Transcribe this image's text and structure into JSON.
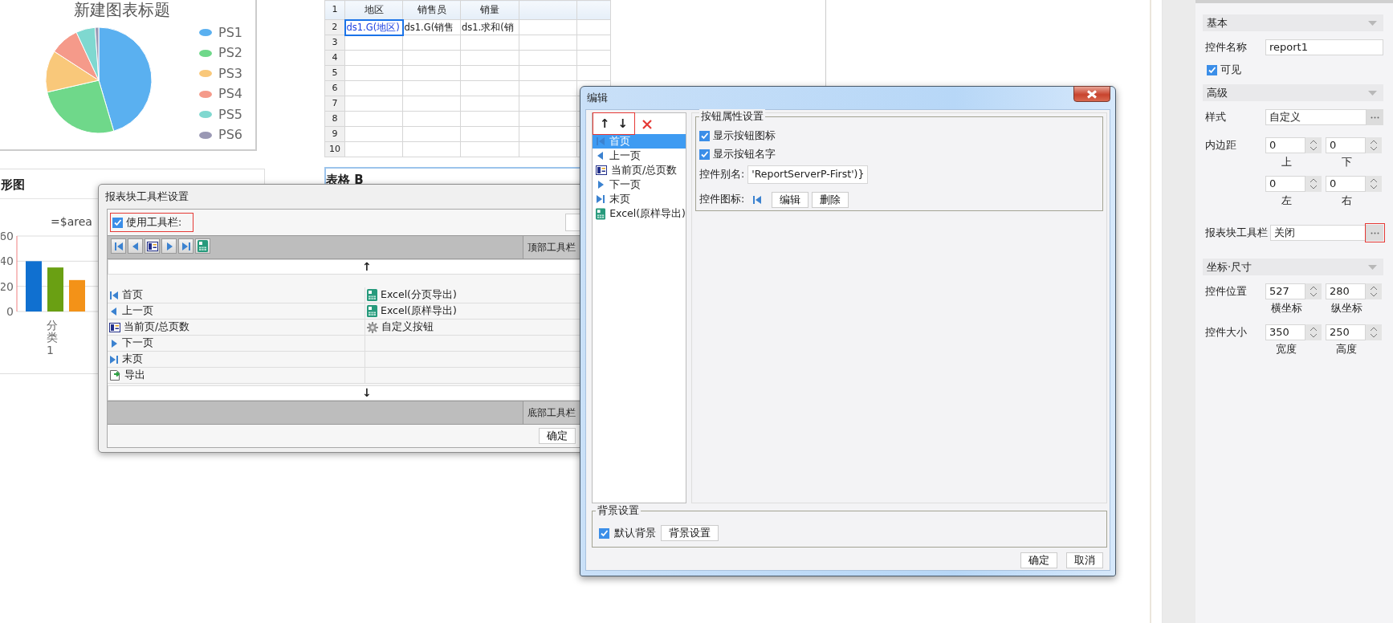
{
  "pie_chart": {
    "title": "新建图表标题",
    "legend": [
      {
        "label": "PS1",
        "color": "#5ab0f0"
      },
      {
        "label": "PS2",
        "color": "#6fd88a"
      },
      {
        "label": "PS3",
        "color": "#f9c87a"
      },
      {
        "label": "PS4",
        "color": "#f59a8a"
      },
      {
        "label": "PS5",
        "color": "#7fd8d0"
      },
      {
        "label": "PS6",
        "color": "#9a98b4"
      }
    ]
  },
  "spreadsheet": {
    "row_numbers": [
      "1",
      "2",
      "3",
      "4",
      "5",
      "6",
      "7",
      "8",
      "9",
      "10"
    ],
    "header": [
      "地区",
      "销售员",
      "销量"
    ],
    "cells": [
      {
        "text": "ds1.G(地区)",
        "selected": true
      },
      {
        "text": "ds1.G(销售",
        "selected": false
      },
      {
        "text": "ds1.求和(销",
        "selected": false
      }
    ]
  },
  "bar_chart": {
    "title": "形图",
    "chart_data": {
      "type": "bar",
      "title": "=$area",
      "categories": [
        "分类1"
      ],
      "series": [
        {
          "color": "#1070d0",
          "values": [
            40
          ]
        },
        {
          "color": "#6aa013",
          "values": [
            35
          ]
        },
        {
          "color": "#f39218",
          "values": [
            25
          ]
        }
      ],
      "ylim": [
        0,
        60
      ],
      "yticks": [
        0,
        20,
        40,
        60
      ]
    }
  },
  "table_b": {
    "title": "表格 B"
  },
  "toolbar_dialog": {
    "title": "报表块工具栏设置",
    "use_toolbar": {
      "label": "使用工具栏:",
      "checked": true,
      "highlighted": true
    },
    "top_toolbar": {
      "label": "顶部工具栏",
      "buttons": [
        {
          "kind": "first"
        },
        {
          "kind": "prev"
        },
        {
          "kind": "page_info"
        },
        {
          "kind": "next"
        },
        {
          "kind": "last"
        },
        {
          "kind": "excel"
        }
      ]
    },
    "move_up": "↑",
    "left_items": [
      {
        "kind": "first",
        "label": "首页"
      },
      {
        "kind": "prev",
        "label": "上一页"
      },
      {
        "kind": "page_info",
        "label": "当前页/总页数"
      },
      {
        "kind": "next",
        "label": "下一页"
      },
      {
        "kind": "last",
        "label": "末页"
      },
      {
        "kind": "export",
        "label": "导出"
      }
    ],
    "right_items": [
      {
        "kind": "excel",
        "label": "Excel(分页导出)"
      },
      {
        "kind": "excel",
        "label": "Excel(原样导出)"
      },
      {
        "kind": "gear",
        "label": "自定义按钮"
      }
    ],
    "move_down": "↓",
    "bottom_toolbar": {
      "label": "底部工具栏"
    },
    "ok_button": "确定"
  },
  "edit_dialog": {
    "title": "编辑",
    "list_tools": {
      "up": "↑",
      "down": "↓",
      "highlighted": true
    },
    "items": [
      {
        "kind": "first",
        "label": "首页",
        "selected": true
      },
      {
        "kind": "prev",
        "label": "上一页",
        "selected": false
      },
      {
        "kind": "page_info",
        "label": "当前页/总页数",
        "selected": false
      },
      {
        "kind": "next",
        "label": "下一页",
        "selected": false
      },
      {
        "kind": "last",
        "label": "末页",
        "selected": false
      },
      {
        "kind": "excel",
        "label": "Excel(原样导出)",
        "selected": false
      }
    ],
    "button_props": {
      "legend": "按钮属性设置",
      "show_icon": {
        "label": "显示按钮图标",
        "checked": true
      },
      "show_name": {
        "label": "显示按钮名字",
        "checked": true
      },
      "alias": {
        "label": "控件别名:",
        "value": "'ReportServerP-First')}"
      },
      "icon_row": {
        "label": "控件图标:",
        "kind": "first",
        "buttons": [
          "编辑",
          "删除"
        ]
      }
    },
    "background": {
      "legend": "背景设置",
      "default_bg": {
        "label": "默认背景",
        "checked": true
      },
      "button": "背景设置"
    },
    "buttons": [
      "确定",
      "取消"
    ]
  },
  "properties": {
    "basic": {
      "header": "基本",
      "name": {
        "label": "控件名称",
        "value": "report1"
      },
      "visible": {
        "label": "可见",
        "checked": true
      }
    },
    "advanced": {
      "header": "高级",
      "style": {
        "label": "样式",
        "value": "自定义"
      },
      "padding": {
        "label": "内边距",
        "fields": [
          {
            "value": "0",
            "caption": "上"
          },
          {
            "value": "0",
            "caption": "下"
          },
          {
            "value": "0",
            "caption": "左"
          },
          {
            "value": "0",
            "caption": "右"
          }
        ]
      },
      "toolbar": {
        "label": "报表块工具栏",
        "value": "关闭",
        "highlighted": true
      }
    },
    "geometry": {
      "header": "坐标·尺寸",
      "position": {
        "label": "控件位置",
        "fields": [
          {
            "value": "527",
            "caption": "横坐标"
          },
          {
            "value": "280",
            "caption": "纵坐标"
          }
        ]
      },
      "size": {
        "label": "控件大小",
        "fields": [
          {
            "value": "350",
            "caption": "宽度"
          },
          {
            "value": "250",
            "caption": "高度"
          }
        ]
      }
    }
  }
}
